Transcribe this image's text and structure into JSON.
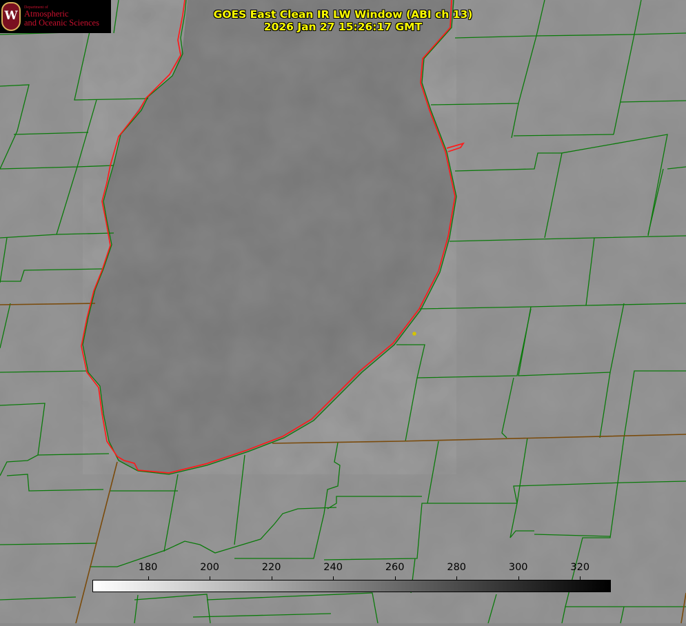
{
  "header": {
    "title_line1": "GOES East Clean IR LW Window (ABI ch 13)",
    "title_line2": "2026 Jan 27 15:26:17 GMT"
  },
  "logo": {
    "dept": "Department of",
    "line1": "Atmospheric",
    "line2": "and Oceanic Sciences",
    "seal_letter": "W"
  },
  "colorbar": {
    "min": 162,
    "max": 330,
    "ticks": [
      {
        "value": 180,
        "label": "180"
      },
      {
        "value": 200,
        "label": "200"
      },
      {
        "value": 220,
        "label": "220"
      },
      {
        "value": 240,
        "label": "240"
      },
      {
        "value": 260,
        "label": "260"
      },
      {
        "value": 280,
        "label": "280"
      },
      {
        "value": 300,
        "label": "300"
      },
      {
        "value": 320,
        "label": "320"
      }
    ]
  },
  "colors": {
    "boundary_green": "#0a7a0a",
    "state_line_brown": "#7a4a0a",
    "lake_outline_red": "#ff1a1a",
    "marker_yellow": "#d4c400",
    "title_yellow": "#ffff00"
  }
}
